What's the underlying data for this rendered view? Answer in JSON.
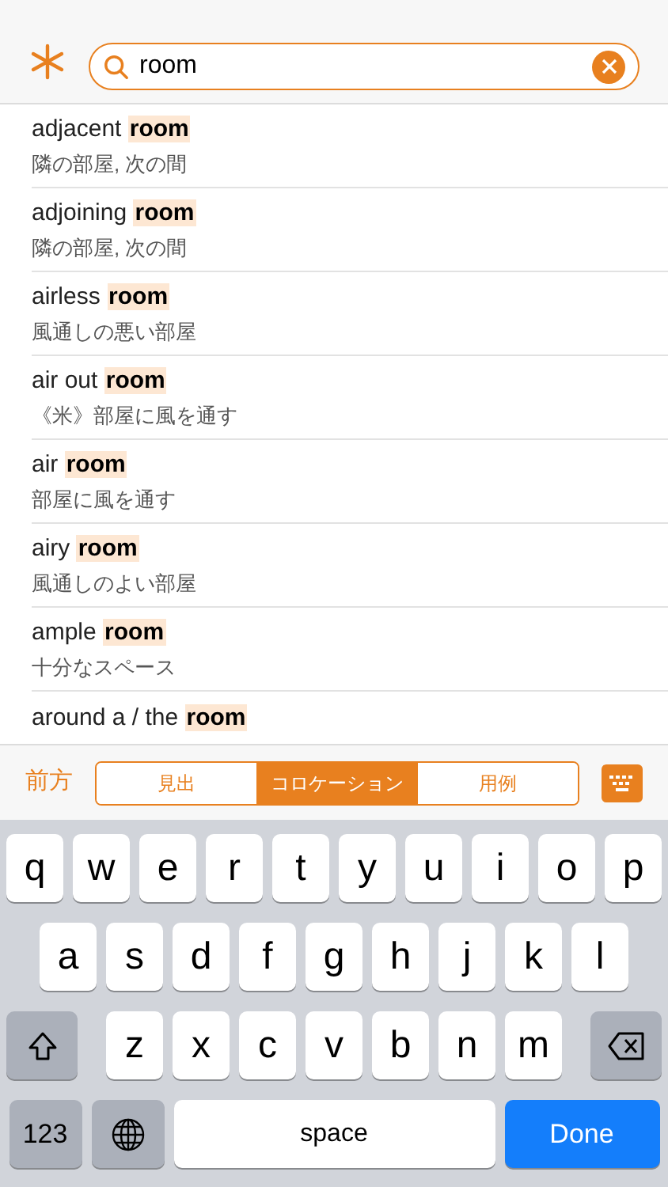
{
  "search": {
    "value": "room"
  },
  "results": [
    {
      "prefix": "adjacent",
      "match": "room",
      "translation": "隣の部屋, 次の間"
    },
    {
      "prefix": "adjoining",
      "match": "room",
      "translation": "隣の部屋, 次の間"
    },
    {
      "prefix": "airless",
      "match": "room",
      "translation": "風通しの悪い部屋"
    },
    {
      "prefix": "air out",
      "match": "room",
      "translation": "《米》部屋に風を通す"
    },
    {
      "prefix": "air",
      "match": "room",
      "translation": "部屋に風を通す"
    },
    {
      "prefix": "airy",
      "match": "room",
      "translation": "風通しのよい部屋"
    },
    {
      "prefix": "ample",
      "match": "room",
      "translation": "十分なスペース"
    },
    {
      "prefix": "around a / the",
      "match": "room"
    }
  ],
  "toolbar": {
    "mode": "前方",
    "segments": [
      {
        "label": "見出",
        "selected": false
      },
      {
        "label": "コロケーション",
        "selected": true
      },
      {
        "label": "用例",
        "selected": false
      }
    ]
  },
  "keyboard": {
    "letter_rows": [
      [
        "q",
        "w",
        "e",
        "r",
        "t",
        "y",
        "u",
        "i",
        "o",
        "p"
      ],
      [
        "a",
        "s",
        "d",
        "f",
        "g",
        "h",
        "j",
        "k",
        "l"
      ],
      [
        "z",
        "x",
        "c",
        "v",
        "b",
        "n",
        "m"
      ]
    ],
    "numbers_key": "123",
    "space_key": "space",
    "done_key": "Done"
  }
}
